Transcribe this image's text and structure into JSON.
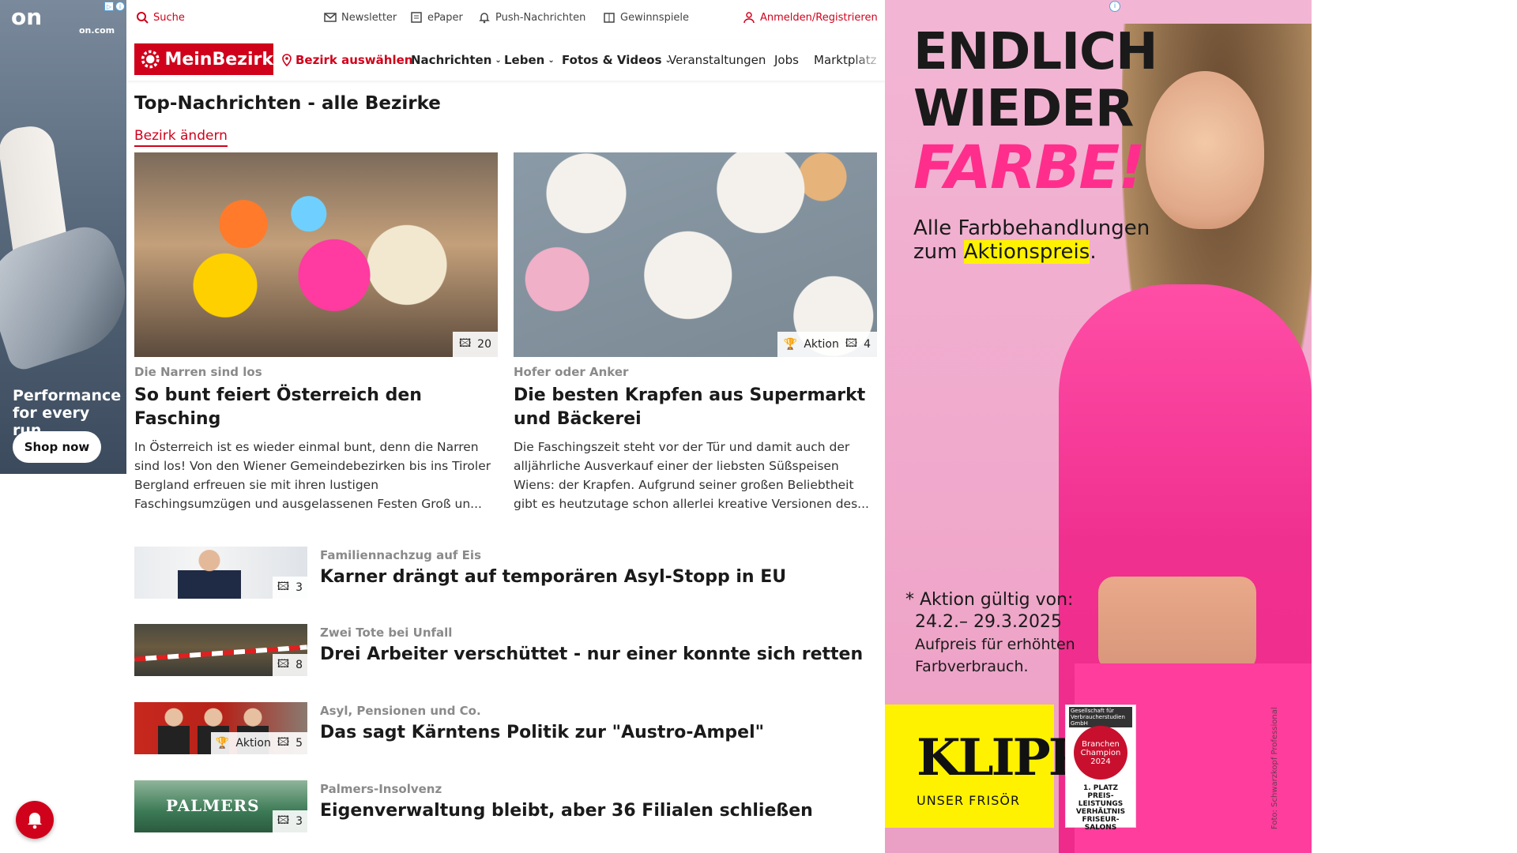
{
  "left_ad": {
    "brand": "on",
    "domain": "on.com",
    "tagline": "Performance for every run",
    "cta": "Shop now"
  },
  "topbar": {
    "search": "Suche",
    "newsletter": "Newsletter",
    "epaper": "ePaper",
    "push": "Push-Nachrichten",
    "gewinnspiele": "Gewinnspiele",
    "login": "Anmelden/Registrieren"
  },
  "nav": {
    "brand": "MeinBezirk",
    "bezirk": "Bezirk auswählen",
    "items": [
      "Nachrichten",
      "Leben",
      "Fotos & Videos",
      "Veranstaltungen",
      "Jobs",
      "Marktplatz"
    ]
  },
  "page": {
    "title": "Top-Nachrichten - alle Bezirke",
    "change_bezirk": "Bezirk ändern"
  },
  "featured": [
    {
      "kicker": "Die Narren sind los",
      "headline": "So bunt feiert Österreich den Fasching",
      "teaser": "In Österreich ist es wieder einmal bunt, denn die Narren sind los! Von den Wiener Gemeindebezirken bis ins Tiroler Bergland erfreuen sie mit ihren lustigen Faschingsumzügen und ausgelassenen Festen Groß un...",
      "photo_count": "20",
      "badge": ""
    },
    {
      "kicker": "Hofer oder Anker",
      "headline": "Die besten Krapfen aus Supermarkt und Bäckerei",
      "teaser": "Die Faschingszeit steht vor der Tür und damit auch der alljährliche Ausverkauf einer der liebsten Süßspeisen Wiens: der Krapfen. Aufgrund seiner großen Beliebtheit gibt es heutzutage schon allerlei kreative Versionen des...",
      "photo_count": "4",
      "badge": "Aktion"
    }
  ],
  "list": [
    {
      "kicker": "Familiennachzug auf Eis",
      "headline": "Karner drängt auf temporären Asyl-Stopp in EU",
      "photo_count": "3",
      "badge": ""
    },
    {
      "kicker": "Zwei Tote bei Unfall",
      "headline": "Drei Arbeiter verschüttet - nur einer konnte sich retten",
      "photo_count": "8",
      "badge": ""
    },
    {
      "kicker": "Asyl, Pensionen und Co.",
      "headline": "Das sagt Kärntens Politik zur \"Austro-Ampel\"",
      "photo_count": "5",
      "badge": "Aktion"
    },
    {
      "kicker": "Palmers-Insolvenz",
      "headline": "Eigenverwaltung bleibt, aber 36 Filialen schließen",
      "photo_count": "3",
      "badge": ""
    }
  ],
  "thumb_text": {
    "palmers": "PALMERS"
  },
  "right_ad": {
    "line1": "ENDLICH",
    "line2": "WIEDER",
    "line3": "FARBE!",
    "sub1": "Alle Farbbehandlungen",
    "sub2_pre": "zum ",
    "sub2_hl": "Aktionspreis",
    "sub2_post": ".",
    "aktion1": "* Aktion gültig von:",
    "aktion2": "24.2.– 29.3.2025",
    "aktion3": "Aufpreis für erhöhten",
    "aktion4": "Farbverbrauch.",
    "klipp": "KLIPP",
    "unser": "UNSER FRISÖR",
    "champ_top": "Gesellschaft für Verbraucherstudien GmbH",
    "champ_circle": "Branchen Champion 2024",
    "champ_place": "1. PLATZ PREIS-LEISTUNGS VERHÄLTNIS FRISEUR-SALONS",
    "foto": "Foto: Schwarzkopf Professional"
  },
  "colors": {
    "brand_red": "#d0021b",
    "ad_pink": "#ff2e8c",
    "highlight_yellow": "#fff200"
  }
}
